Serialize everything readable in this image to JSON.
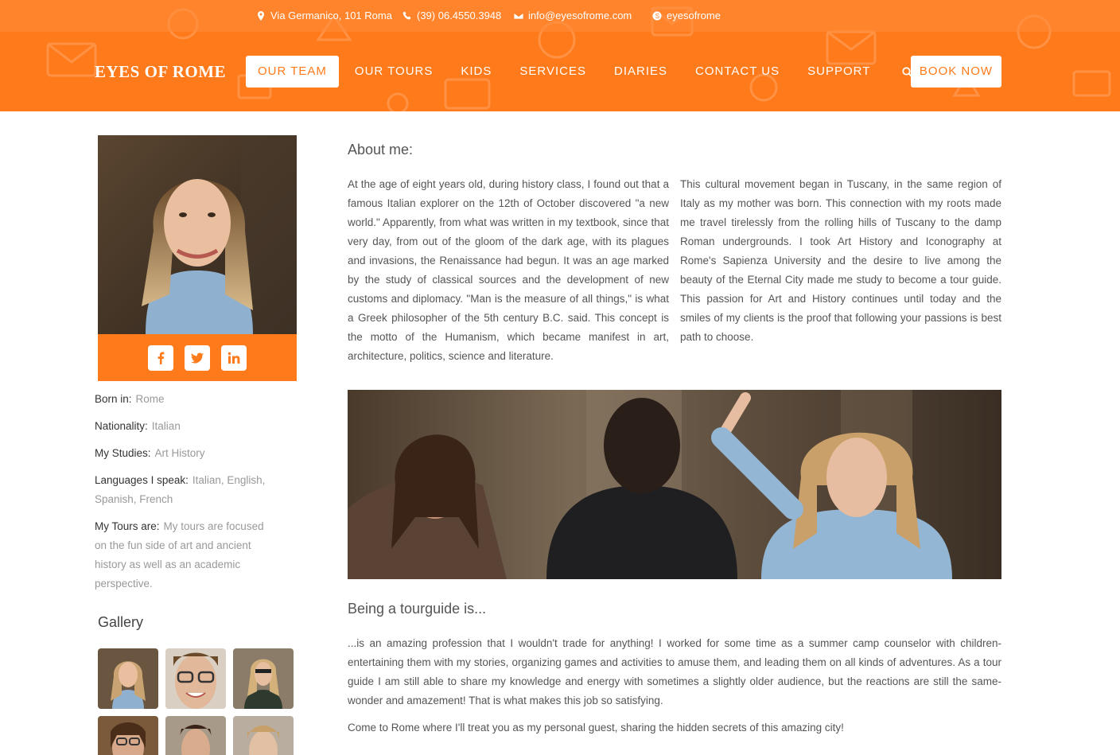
{
  "colors": {
    "brand": "#ff7a1a",
    "text": "#555555",
    "muted": "#999999"
  },
  "topbar": {
    "address": "Via Germanico, 101 Roma",
    "phone": "(39) 06.4550.3948",
    "email": "info@eyesofrome.com",
    "skype": "eyesofrome"
  },
  "logo": "EYES OF ROME",
  "nav": {
    "items": [
      "OUR TEAM",
      "OUR TOURS",
      "KIDS",
      "SERVICES",
      "DIARIES",
      "CONTACT US",
      "SUPPORT"
    ],
    "search_icon": "search-icon",
    "book_label": "BOOK NOW"
  },
  "profile": {
    "social": [
      "facebook-icon",
      "twitter-icon",
      "linkedin-icon"
    ],
    "facts": [
      {
        "label": "Born in:",
        "value": "Rome"
      },
      {
        "label": "Nationality:",
        "value": "Italian"
      },
      {
        "label": "My Studies:",
        "value": "Art History"
      },
      {
        "label": "Languages I speak:",
        "value": "Italian, English, Spanish, French"
      },
      {
        "label": "My Tours are:",
        "value": "My tours are focused on the fun side of art and ancient history as well as an academic perspective."
      }
    ]
  },
  "gallery": {
    "title": "Gallery"
  },
  "about": {
    "title": "About me:",
    "col1": "At the age of eight years old, during history class, I found out that a famous Italian explorer on the 12th of October discovered \"a new world.\" Apparently, from what was written in my textbook, since that very day, from out of the gloom of the dark age, with its plagues and invasions, the Renaissance had begun. It was an age marked by the study of classical sources and the development of new customs and diplomacy. \"Man is the measure of all things,\" is what a Greek philosopher of the 5th century B.C. said. This concept is the motto of the Humanism, which became manifest in art, architecture, politics, science and literature.",
    "col2": "This cultural movement began in Tuscany, in the same region of Italy as my mother was born. This connection with my roots made me travel tirelessly from the rolling hills of Tuscany to the damp Roman undergrounds. I took Art History and Iconography at Rome's Sapienza University and the desire to live among the beauty of the Eternal City made me study to become a tour guide. This passion for Art and History continues until today and the smiles of my clients is the proof that following your passions is best path to choose."
  },
  "tourguide": {
    "title": "Being a tourguide is...",
    "para1": "...is an amazing profession that I wouldn't trade for anything! I worked for some time as a summer camp counselor with children- entertaining them with my stories, organizing games and activities to amuse them, and leading them on all kinds of adventures. As a tour guide I am still able to share my knowledge and energy with sometimes a slightly older audience, but the reactions are still the same- wonder and amazement! That is what makes this job so satisfying.",
    "para2": "Come to Rome where I'll treat you as my personal guest, sharing the hidden secrets of this amazing city!"
  }
}
